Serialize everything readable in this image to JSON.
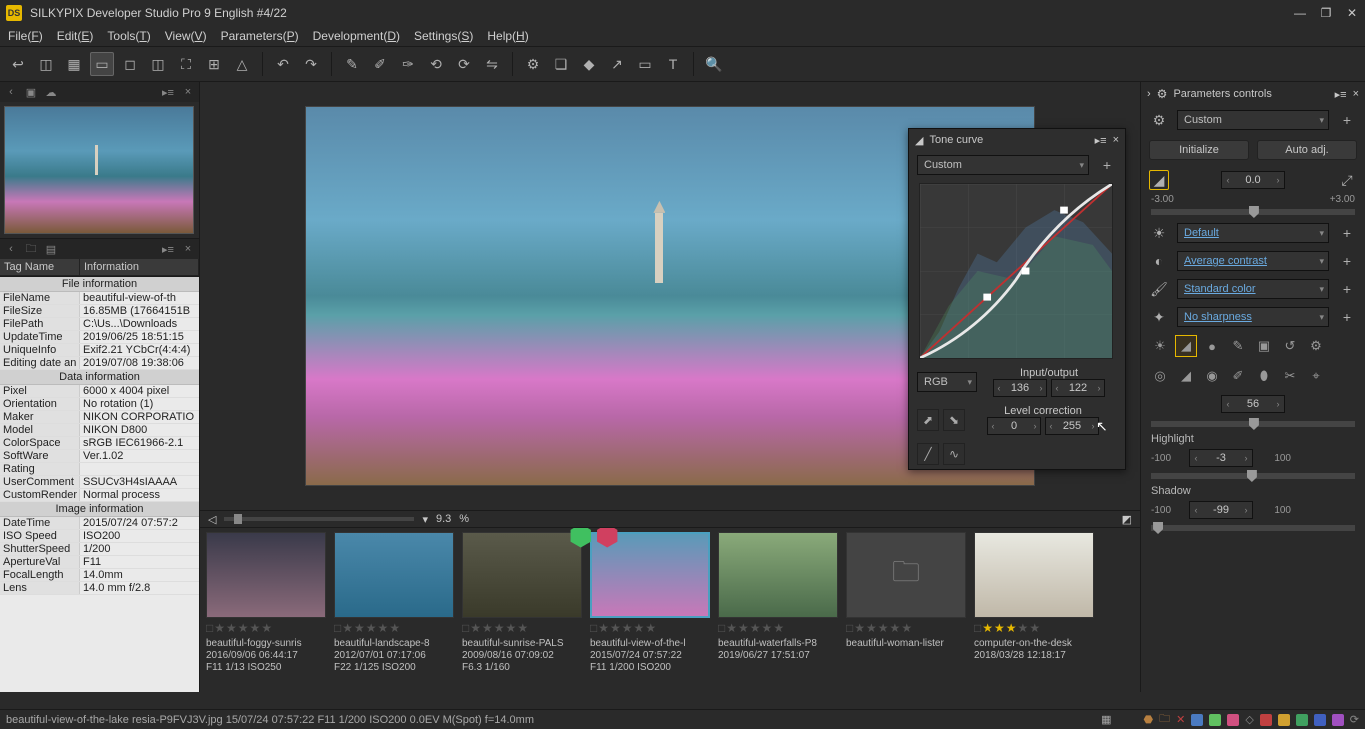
{
  "title": "SILKYPIX Developer Studio Pro 9 English   #4/22",
  "menu": [
    "File(F)",
    "Edit(E)",
    "Tools(T)",
    "View(V)",
    "Parameters(P)",
    "Development(D)",
    "Settings(S)",
    "Help(H)"
  ],
  "zoom": "9.3",
  "zoom_unit": "%",
  "info": {
    "headers": [
      "Tag Name",
      "Information"
    ],
    "sections": [
      {
        "title": "File information",
        "rows": [
          [
            "FileName",
            "beautiful-view-of-th"
          ],
          [
            "FileSize",
            "16.85MB (17664151B"
          ],
          [
            "FilePath",
            "C:\\Us...\\Downloads"
          ],
          [
            "UpdateTime",
            "2019/06/25 18:51:15"
          ],
          [
            "UniqueInfo",
            "Exif2.21 YCbCr(4:4:4)"
          ],
          [
            "Editing date an",
            "2019/07/08 19:38:06"
          ]
        ]
      },
      {
        "title": "Data information",
        "rows": [
          [
            "Pixel",
            "6000 x 4004 pixel"
          ],
          [
            "Orientation",
            "No rotation (1)"
          ],
          [
            "Maker",
            "NIKON CORPORATIO"
          ],
          [
            "Model",
            "NIKON D800"
          ],
          [
            "ColorSpace",
            "sRGB IEC61966-2.1"
          ],
          [
            "SoftWare",
            "Ver.1.02"
          ],
          [
            "Rating",
            ""
          ],
          [
            "UserComment",
            "SSUCv3H4sIAAAA"
          ],
          [
            "CustomRender",
            "Normal process"
          ]
        ]
      },
      {
        "title": "Image information",
        "rows": [
          [
            "DateTime",
            "2015/07/24 07:57:2"
          ],
          [
            "ISO Speed",
            "ISO200"
          ],
          [
            "ShutterSpeed",
            "1/200"
          ],
          [
            "ApertureVal",
            "F11"
          ],
          [
            "FocalLength",
            "14.0mm"
          ],
          [
            "Lens",
            "14.0 mm f/2.8"
          ]
        ]
      }
    ]
  },
  "thumbs": [
    {
      "name": "beautiful-foggy-sunris",
      "date": "2016/09/06 06:44:17",
      "meta": "F11 1/13 ISO250",
      "stars": 0,
      "bg": "linear-gradient(180deg,#3a3a4a,#8a6a7a)"
    },
    {
      "name": "beautiful-landscape-8",
      "date": "2012/07/01 07:17:06",
      "meta": "F22 1/125 ISO200",
      "stars": 0,
      "bg": "linear-gradient(180deg,#4a88aa,#2a6a8a)"
    },
    {
      "name": "beautiful-sunrise-PALS",
      "date": "2009/08/16 07:09:02",
      "meta": "F6.3 1/160",
      "stars": 0,
      "bg": "linear-gradient(180deg,#5a5a4a,#3a3a2a)"
    },
    {
      "name": "beautiful-view-of-the-l",
      "date": "2015/07/24 07:57:22",
      "meta": "F11 1/200 ISO200",
      "stars": 0,
      "sel": true,
      "bg": "linear-gradient(180deg,#5a9ab8,#c878b8)"
    },
    {
      "name": "beautiful-waterfalls-P8",
      "date": "2019/06/27 17:51:07",
      "meta": "",
      "stars": 0,
      "bg": "linear-gradient(180deg,#8aaa7a,#4a6a4a)"
    },
    {
      "name": "beautiful-woman-lister",
      "date": "",
      "meta": "",
      "stars": 0,
      "folder": true
    },
    {
      "name": "computer-on-the-desk",
      "date": "2018/03/28 12:18:17",
      "meta": "",
      "stars": 3,
      "bg": "linear-gradient(180deg,#e8e8e0,#c0b8a8)"
    }
  ],
  "right": {
    "panel_title": "Parameters controls",
    "preset": "Custom",
    "initialize": "Initialize",
    "autoadj": "Auto adj.",
    "exposure": "0.0",
    "exp_min": "-3.00",
    "exp_max": "+3.00",
    "wb": "Default",
    "contrast": "Average contrast",
    "color": "Standard color",
    "sharp": "No sharpness",
    "mid": "56",
    "hl_label": "Highlight",
    "hl_min": "-100",
    "hl_val": "-3",
    "hl_max": "100",
    "sh_label": "Shadow",
    "sh_min": "-100",
    "sh_val": "-99",
    "sh_max": "100"
  },
  "tone": {
    "title": "Tone curve",
    "preset": "Custom",
    "channel": "RGB",
    "io_label": "Input/output",
    "in": "136",
    "out": "122",
    "lc_label": "Level correction",
    "black": "0",
    "white": "255"
  },
  "status": "beautiful-view-of-the-lake resia-P9FVJ3V.jpg 15/07/24 07:57:22 F11 1/200 ISO200  0.0EV M(Spot) f=14.0mm"
}
